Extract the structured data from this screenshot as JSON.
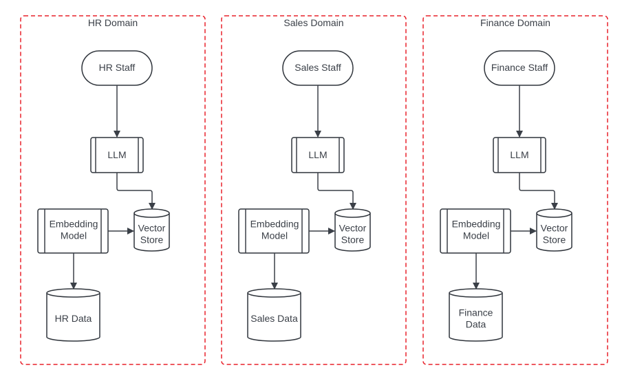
{
  "colors": {
    "domain_border": "#e8202a",
    "shape_stroke": "#2f343b",
    "text": "#3a3f47"
  },
  "domains": [
    {
      "title": "HR Domain",
      "staff": "HR Staff",
      "llm": "LLM",
      "embedding": [
        "Embedding",
        "Model"
      ],
      "vector_store": [
        "Vector",
        "Store"
      ],
      "data_store": [
        "HR Data"
      ]
    },
    {
      "title": "Sales Domain",
      "staff": "Sales Staff",
      "llm": "LLM",
      "embedding": [
        "Embedding",
        "Model"
      ],
      "vector_store": [
        "Vector",
        "Store"
      ],
      "data_store": [
        "Sales Data"
      ]
    },
    {
      "title": "Finance Domain",
      "staff": "Finance Staff",
      "llm": "LLM",
      "embedding": [
        "Embedding",
        "Model"
      ],
      "vector_store": [
        "Vector",
        "Store"
      ],
      "data_store": [
        "Finance",
        "Data"
      ]
    }
  ]
}
